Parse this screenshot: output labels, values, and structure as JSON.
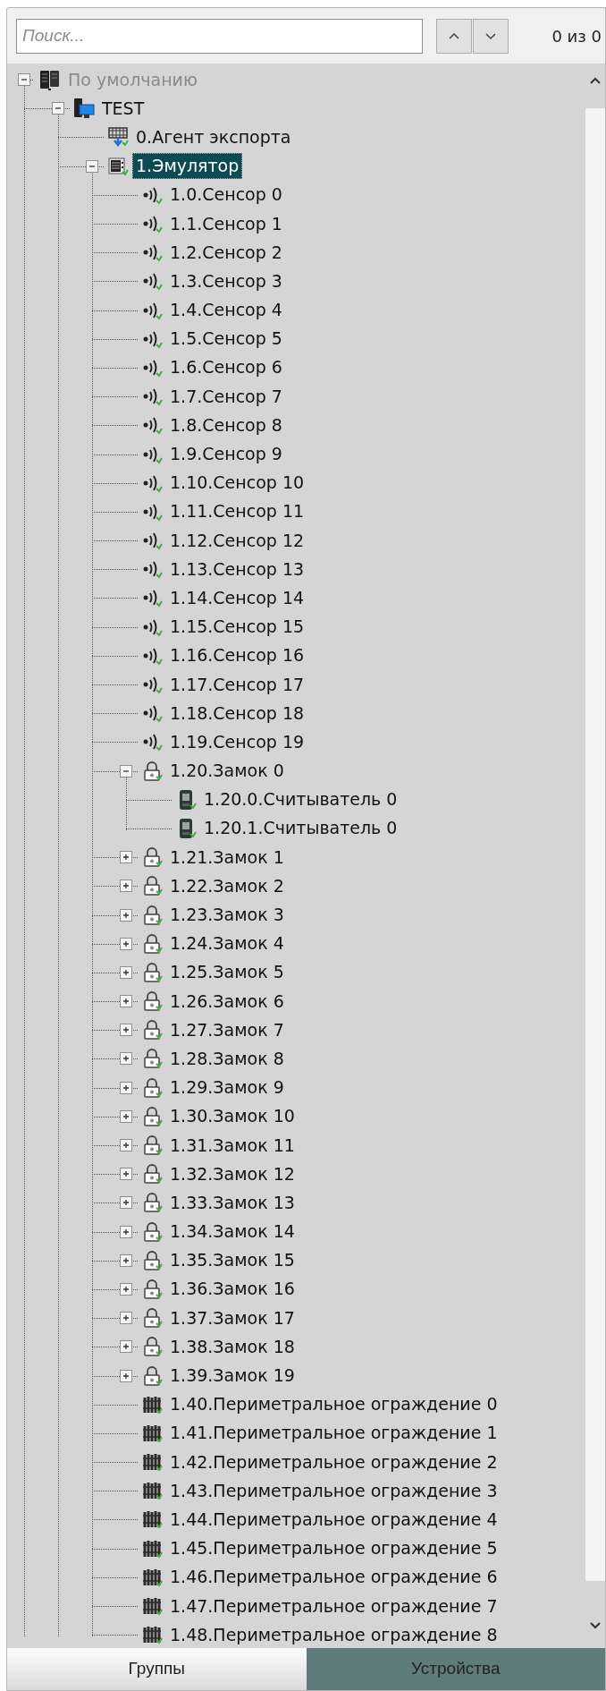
{
  "search": {
    "placeholder": "Поиск..."
  },
  "match_count": "0 из 0",
  "tree": [
    {
      "label": "По умолчанию",
      "kind": "server",
      "selected": false,
      "expanded": true,
      "children": [
        {
          "label": "TEST",
          "kind": "computer",
          "selected": false,
          "expanded": true,
          "children": [
            {
              "label": "0.Агент экспорта",
              "kind": "export-agent",
              "selected": false
            },
            {
              "label": "1.Эмулятор",
              "kind": "emulator",
              "selected": true,
              "expanded": true,
              "children": [
                {
                  "label": "1.0.Сенсор 0",
                  "kind": "sensor",
                  "selected": false
                },
                {
                  "label": "1.1.Сенсор 1",
                  "kind": "sensor",
                  "selected": false
                },
                {
                  "label": "1.2.Сенсор 2",
                  "kind": "sensor",
                  "selected": false
                },
                {
                  "label": "1.3.Сенсор 3",
                  "kind": "sensor",
                  "selected": false
                },
                {
                  "label": "1.4.Сенсор 4",
                  "kind": "sensor",
                  "selected": false
                },
                {
                  "label": "1.5.Сенсор 5",
                  "kind": "sensor",
                  "selected": false
                },
                {
                  "label": "1.6.Сенсор 6",
                  "kind": "sensor",
                  "selected": false
                },
                {
                  "label": "1.7.Сенсор 7",
                  "kind": "sensor",
                  "selected": false
                },
                {
                  "label": "1.8.Сенсор 8",
                  "kind": "sensor",
                  "selected": false
                },
                {
                  "label": "1.9.Сенсор 9",
                  "kind": "sensor",
                  "selected": false
                },
                {
                  "label": "1.10.Сенсор 10",
                  "kind": "sensor",
                  "selected": false
                },
                {
                  "label": "1.11.Сенсор 11",
                  "kind": "sensor",
                  "selected": false
                },
                {
                  "label": "1.12.Сенсор 12",
                  "kind": "sensor",
                  "selected": false
                },
                {
                  "label": "1.13.Сенсор 13",
                  "kind": "sensor",
                  "selected": false
                },
                {
                  "label": "1.14.Сенсор 14",
                  "kind": "sensor",
                  "selected": false
                },
                {
                  "label": "1.15.Сенсор 15",
                  "kind": "sensor",
                  "selected": false
                },
                {
                  "label": "1.16.Сенсор 16",
                  "kind": "sensor",
                  "selected": false
                },
                {
                  "label": "1.17.Сенсор 17",
                  "kind": "sensor",
                  "selected": false
                },
                {
                  "label": "1.18.Сенсор 18",
                  "kind": "sensor",
                  "selected": false
                },
                {
                  "label": "1.19.Сенсор 19",
                  "kind": "sensor",
                  "selected": false
                },
                {
                  "label": "1.20.Замок 0",
                  "kind": "lock",
                  "selected": false,
                  "expanded": true,
                  "children": [
                    {
                      "label": "1.20.0.Считыватель 0",
                      "kind": "reader",
                      "selected": false
                    },
                    {
                      "label": "1.20.1.Считыватель 0",
                      "kind": "reader",
                      "selected": false
                    }
                  ]
                },
                {
                  "label": "1.21.Замок 1",
                  "kind": "lock",
                  "selected": false,
                  "expanded": false
                },
                {
                  "label": "1.22.Замок 2",
                  "kind": "lock",
                  "selected": false,
                  "expanded": false
                },
                {
                  "label": "1.23.Замок 3",
                  "kind": "lock",
                  "selected": false,
                  "expanded": false
                },
                {
                  "label": "1.24.Замок 4",
                  "kind": "lock",
                  "selected": false,
                  "expanded": false
                },
                {
                  "label": "1.25.Замок 5",
                  "kind": "lock",
                  "selected": false,
                  "expanded": false
                },
                {
                  "label": "1.26.Замок 6",
                  "kind": "lock",
                  "selected": false,
                  "expanded": false
                },
                {
                  "label": "1.27.Замок 7",
                  "kind": "lock",
                  "selected": false,
                  "expanded": false
                },
                {
                  "label": "1.28.Замок 8",
                  "kind": "lock",
                  "selected": false,
                  "expanded": false
                },
                {
                  "label": "1.29.Замок 9",
                  "kind": "lock",
                  "selected": false,
                  "expanded": false
                },
                {
                  "label": "1.30.Замок 10",
                  "kind": "lock",
                  "selected": false,
                  "expanded": false
                },
                {
                  "label": "1.31.Замок 11",
                  "kind": "lock",
                  "selected": false,
                  "expanded": false
                },
                {
                  "label": "1.32.Замок 12",
                  "kind": "lock",
                  "selected": false,
                  "expanded": false
                },
                {
                  "label": "1.33.Замок 13",
                  "kind": "lock",
                  "selected": false,
                  "expanded": false
                },
                {
                  "label": "1.34.Замок 14",
                  "kind": "lock",
                  "selected": false,
                  "expanded": false
                },
                {
                  "label": "1.35.Замок 15",
                  "kind": "lock",
                  "selected": false,
                  "expanded": false
                },
                {
                  "label": "1.36.Замок 16",
                  "kind": "lock",
                  "selected": false,
                  "expanded": false
                },
                {
                  "label": "1.37.Замок 17",
                  "kind": "lock",
                  "selected": false,
                  "expanded": false
                },
                {
                  "label": "1.38.Замок 18",
                  "kind": "lock",
                  "selected": false,
                  "expanded": false
                },
                {
                  "label": "1.39.Замок 19",
                  "kind": "lock",
                  "selected": false,
                  "expanded": false
                },
                {
                  "label": "1.40.Периметральное ограждение 0",
                  "kind": "fence",
                  "selected": false
                },
                {
                  "label": "1.41.Периметральное ограждение 1",
                  "kind": "fence",
                  "selected": false
                },
                {
                  "label": "1.42.Периметральное ограждение 2",
                  "kind": "fence",
                  "selected": false
                },
                {
                  "label": "1.43.Периметральное ограждение 3",
                  "kind": "fence",
                  "selected": false
                },
                {
                  "label": "1.44.Периметральное ограждение 4",
                  "kind": "fence",
                  "selected": false
                },
                {
                  "label": "1.45.Периметральное ограждение 5",
                  "kind": "fence",
                  "selected": false
                },
                {
                  "label": "1.46.Периметральное ограждение 6",
                  "kind": "fence",
                  "selected": false
                },
                {
                  "label": "1.47.Периметральное ограждение 7",
                  "kind": "fence",
                  "selected": false
                },
                {
                  "label": "1.48.Периметральное ограждение 8",
                  "kind": "fence",
                  "selected": false
                }
              ]
            }
          ]
        }
      ]
    }
  ],
  "tabs": [
    {
      "label": "Группы",
      "selected": false
    },
    {
      "label": "Устройства",
      "selected": true
    }
  ]
}
